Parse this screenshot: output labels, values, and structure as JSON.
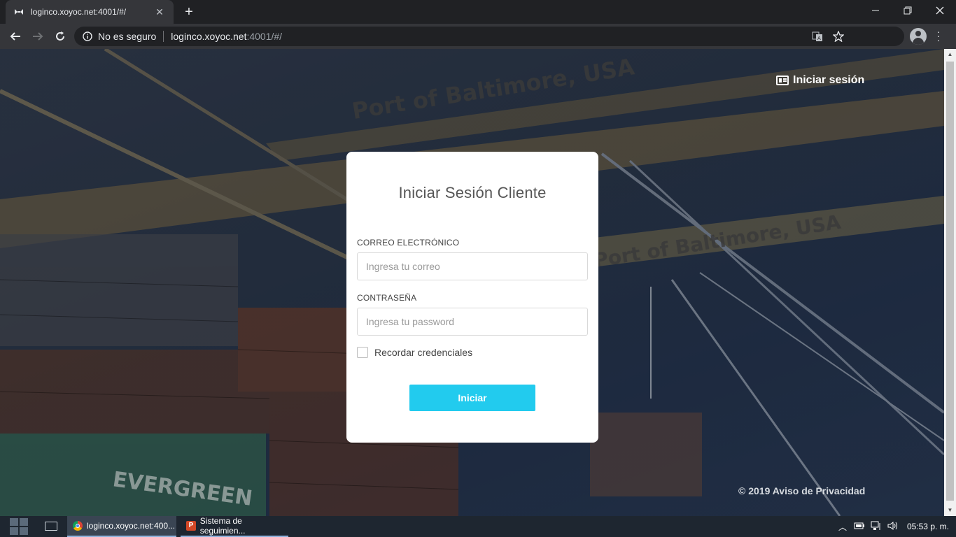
{
  "browser": {
    "tab_title": "loginco.xoyoc.net:4001/#/",
    "tab_close": "✕",
    "new_tab": "+",
    "security_label": "No es seguro",
    "url_host": "loginco.xoyoc.net",
    "url_rest": ":4001/#/"
  },
  "header": {
    "login_link": "Iniciar sesión"
  },
  "login_card": {
    "title": "Iniciar Sesión Cliente",
    "email_label": "CORREO ELECTRÓNICO",
    "email_placeholder": "Ingresa tu correo",
    "password_label": "CONTRASEÑA",
    "password_placeholder": "Ingresa tu password",
    "remember_label": "Recordar credenciales",
    "remember_checked": false,
    "submit_label": "Iniciar"
  },
  "footer": {
    "text": "© 2019 Aviso de Privacidad"
  },
  "background_texts": {
    "sign_top": "Port of Baltimore, USA",
    "sign_mid": "Port of Baltimore, USA",
    "container_brand": "EVERGREEN"
  },
  "taskbar": {
    "items": [
      {
        "label": "loginco.xoyoc.net:400...",
        "icon": "chrome-icon"
      },
      {
        "label": "Sistema de seguimien...",
        "icon": "powerpoint-icon",
        "icon_letter": "P"
      }
    ],
    "clock": "05:53 p. m."
  },
  "colors": {
    "accent_button": "#22cbee",
    "card_bg": "#ffffff",
    "chrome_bg": "#35363a"
  }
}
